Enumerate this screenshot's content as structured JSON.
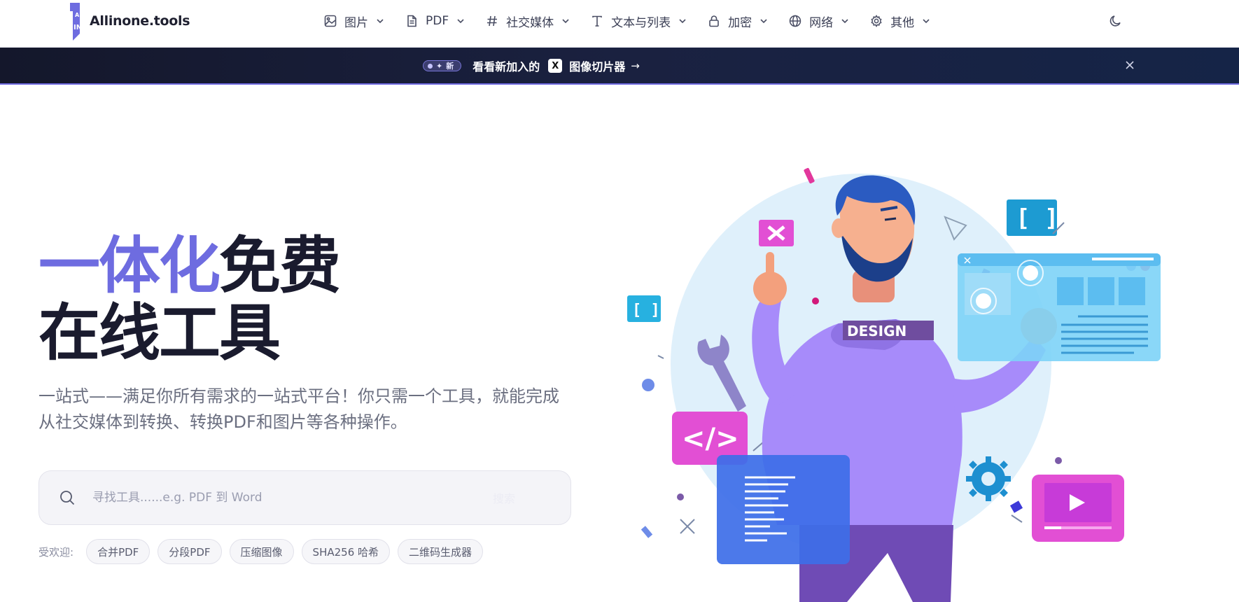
{
  "header": {
    "brand": "Allinone.tools",
    "nav": [
      {
        "label": "图片",
        "icon": "image-icon"
      },
      {
        "label": "PDF",
        "icon": "document-icon"
      },
      {
        "label": "社交媒体",
        "icon": "hash-icon"
      },
      {
        "label": "文本与列表",
        "icon": "text-icon"
      },
      {
        "label": "加密",
        "icon": "lock-icon"
      },
      {
        "label": "网络",
        "icon": "globe-icon"
      },
      {
        "label": "其他",
        "icon": "gear-icon"
      }
    ],
    "theme_icon": "moon-icon"
  },
  "banner": {
    "pill": "新",
    "text": "看看新加入的",
    "badge": "X",
    "link": "图像切片器",
    "arrow": "→",
    "close_icon": "close-icon"
  },
  "hero": {
    "title_accent": "一体化",
    "title_rest": "免费",
    "title_line2": "在线工具",
    "subtitle": "一站式——满足你所有需求的一站式平台！你只需一个工具，就能完成从社交媒体到转换、转换PDF和图片等各种操作。"
  },
  "search": {
    "placeholder": "寻找工具......e.g. PDF 到 Word",
    "button": "搜索"
  },
  "popular": {
    "label": "受欢迎:",
    "chips": [
      "合并PDF",
      "分段PDF",
      "压缩图像",
      "SHA256 哈希",
      "二维码生成器"
    ]
  },
  "illustration": {
    "shirt_text": "DESIGN",
    "colors": {
      "accent": "#6e6ce0",
      "purple": "#a78bfa",
      "pink": "#e24fd4",
      "cyan": "#27b1e0",
      "blue": "#3d6ee8"
    }
  }
}
